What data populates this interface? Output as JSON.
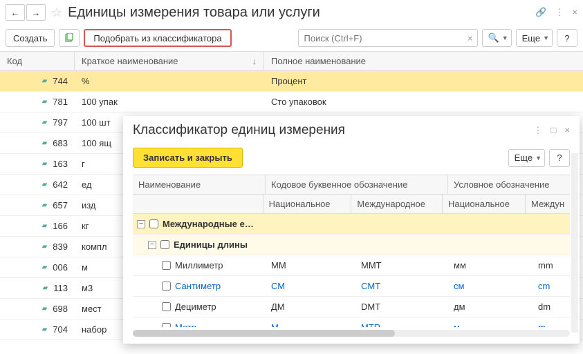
{
  "main": {
    "title": "Единицы измерения товара или услуги",
    "create": "Создать",
    "pick": "Подобрать из классификатора",
    "search_placeholder": "Поиск (Ctrl+F)",
    "more": "Еще",
    "help": "?",
    "columns": {
      "code": "Код",
      "short": "Краткое наименование",
      "full": "Полное наименование"
    },
    "rows": [
      {
        "code": "744",
        "short": "%",
        "full": "Процент",
        "sel": true
      },
      {
        "code": "781",
        "short": "100 упак",
        "full": "Сто упаковок"
      },
      {
        "code": "797",
        "short": "100 шт"
      },
      {
        "code": "683",
        "short": "100 ящ"
      },
      {
        "code": "163",
        "short": "г"
      },
      {
        "code": "642",
        "short": "ед"
      },
      {
        "code": "657",
        "short": "изд"
      },
      {
        "code": "166",
        "short": "кг"
      },
      {
        "code": "839",
        "short": "компл"
      },
      {
        "code": "006",
        "short": "м"
      },
      {
        "code": "113",
        "short": "м3"
      },
      {
        "code": "698",
        "short": "мест"
      },
      {
        "code": "704",
        "short": "набор"
      }
    ]
  },
  "dialog": {
    "title": "Классификатор единиц измерения",
    "save_close": "Записать и закрыть",
    "more": "Еще",
    "help": "?",
    "columns": {
      "name": "Наименование",
      "letter": "Кодовое буквенное обозначение",
      "cond": "Условное обозначение",
      "national": "Национальное",
      "international": "Международное",
      "international_short": "Междун"
    },
    "group1": "Международные е…",
    "group2": "Единицы длины",
    "rows": [
      {
        "name": "Миллиметр",
        "nat1": "ММ",
        "int1": "MMT",
        "nat2": "мм",
        "int2": "mm"
      },
      {
        "name": "Сантиметр",
        "nat1": "СМ",
        "int1": "CMT",
        "nat2": "см",
        "int2": "cm",
        "link": true
      },
      {
        "name": "Дециметр",
        "nat1": "ДМ",
        "int1": "DMT",
        "nat2": "дм",
        "int2": "dm"
      },
      {
        "name": "Метр",
        "nat1": "М",
        "int1": "MTR",
        "nat2": "м",
        "int2": "m",
        "link": true
      }
    ]
  }
}
